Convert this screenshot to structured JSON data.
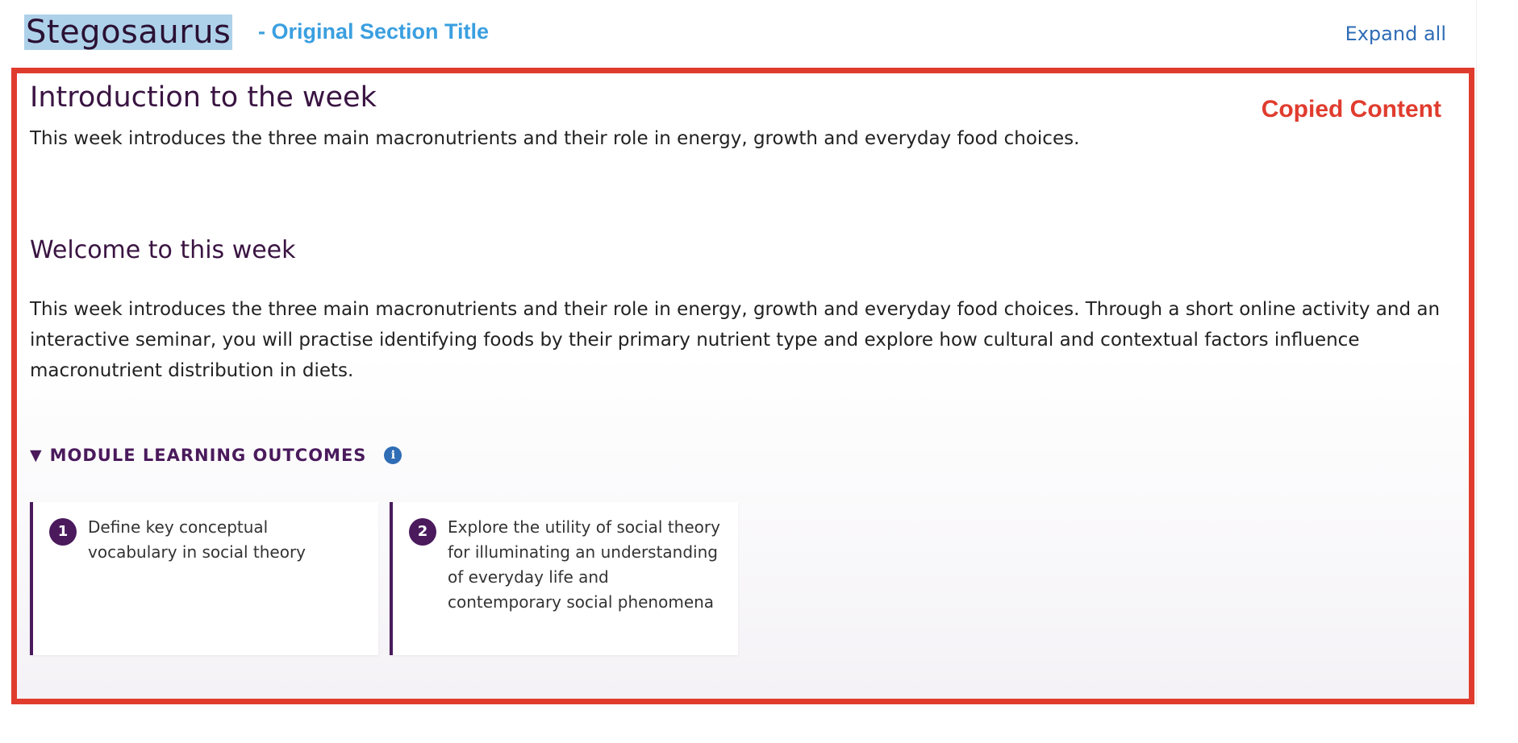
{
  "section": {
    "title": "Stegosaurus",
    "original_label": "- Original Section Title",
    "expand_all": "Expand all"
  },
  "copied": {
    "label": "Copied Content",
    "intro_heading": "Introduction to the week",
    "intro_text": "This week introduces the three main macronutrients and their role in energy, growth and everyday food choices.",
    "welcome_heading": "Welcome to this week",
    "welcome_text": "This week introduces the three main macronutrients and their role in energy, growth and everyday food choices. Through a short online activity and an interactive seminar, you will practise identifying foods by their primary nutrient type and explore how cultural and contextual factors influence macronutrient distribution in diets."
  },
  "outcomes": {
    "toggle_icon": "▼",
    "label": "MODULE LEARNING OUTCOMES",
    "info_icon": "i",
    "items": [
      {
        "number": "1",
        "text": "Define key conceptual vocabulary in social theory"
      },
      {
        "number": "2",
        "text": "Explore the utility of social theory for illuminating an understanding of everyday life and contemporary social phenomena"
      }
    ]
  },
  "colors": {
    "accent_purple": "#4a1a5c",
    "highlight_box": "#e03c2e",
    "original_label": "#3a9fe0",
    "link_blue": "#2f6db5"
  }
}
